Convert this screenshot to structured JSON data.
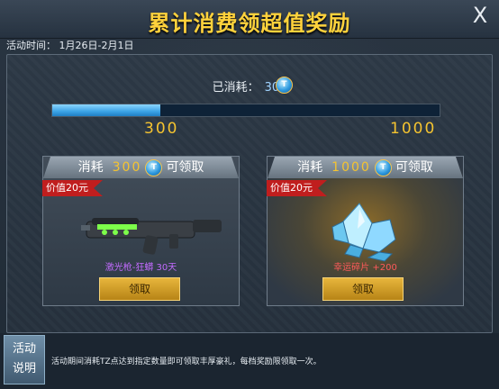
{
  "header": {
    "title": "累计消费领超值奖励",
    "close_symbol": "X"
  },
  "event": {
    "time_label": "活动时间：",
    "time_value": "1月26日-2月1日"
  },
  "progress": {
    "consumed_label": "已消耗：",
    "consumed_value": "300",
    "currency_icon": "tz-coin-icon",
    "current": 300,
    "max": 1000,
    "fraction": 0.28,
    "left_tick": "300",
    "right_tick": "1000"
  },
  "rewards": [
    {
      "cost_label": "消耗",
      "cost_value": "300",
      "claimable_label": "可领取",
      "price_tag": "价值20元",
      "item_name": "激光枪-狂蟒 30天",
      "item_icon": "laser-rifle-icon",
      "claim_label": "领取"
    },
    {
      "cost_label": "消耗",
      "cost_value": "1000",
      "claimable_label": "可领取",
      "price_tag": "价值20元",
      "item_name": "幸运碎片 +200",
      "item_icon": "crystal-shards-icon",
      "claim_label": "领取"
    }
  ],
  "footer": {
    "explain_line1": "活动",
    "explain_line2": "说明",
    "description": "活动期间消耗TZ点达到指定数量即可领取丰厚豪礼，每档奖励限领取一次。"
  },
  "colors": {
    "title": "#ffd23c",
    "accent_gold": "#f5c430",
    "price_tag": "#c01e1e",
    "progress_fill": "#3ba3e6"
  }
}
